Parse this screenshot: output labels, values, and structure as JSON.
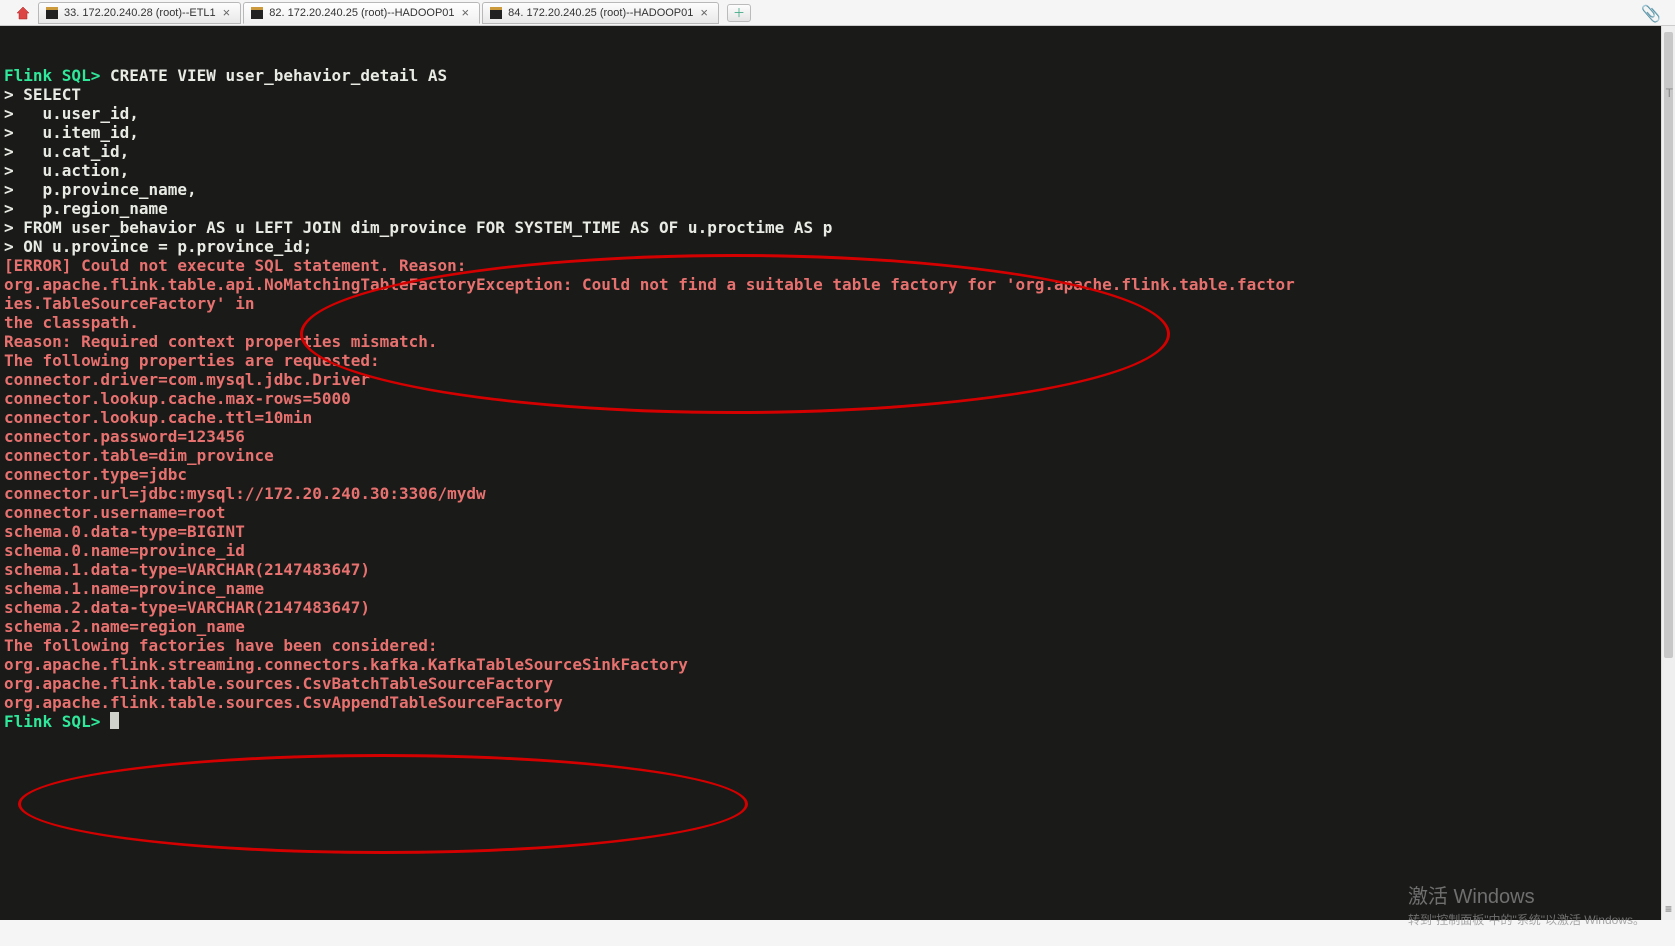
{
  "tabs": [
    {
      "label": "33. 172.20.240.28 (root)--ETL1",
      "active": false
    },
    {
      "label": "82. 172.20.240.25 (root)--HADOOP01",
      "active": true
    },
    {
      "label": "84. 172.20.240.25 (root)--HADOOP01",
      "active": false
    }
  ],
  "terminal": {
    "prompt": "Flink SQL>",
    "sql_first": " CREATE VIEW user_behavior_detail AS",
    "sql_cont": [
      "> SELECT ",
      ">   u.user_id,",
      ">   u.item_id,",
      ">   u.cat_id,",
      ">   u.action,",
      ">   p.province_name,",
      ">   p.region_name",
      "> FROM user_behavior AS u LEFT JOIN dim_province FOR SYSTEM_TIME AS OF u.proctime AS p",
      "> ON u.province = p.province_id;"
    ],
    "error": [
      "[ERROR] Could not execute SQL statement. Reason:",
      "org.apache.flink.table.api.NoMatchingTableFactoryException: Could not find a suitable table factory for 'org.apache.flink.table.factor",
      "ies.TableSourceFactory' in",
      "the classpath.",
      "",
      "Reason: Required context properties mismatch.",
      "",
      "The following properties are requested:",
      "connector.driver=com.mysql.jdbc.Driver",
      "connector.lookup.cache.max-rows=5000",
      "connector.lookup.cache.ttl=10min",
      "connector.password=123456",
      "connector.table=dim_province",
      "connector.type=jdbc",
      "connector.url=jdbc:mysql://172.20.240.30:3306/mydw",
      "connector.username=root",
      "schema.0.data-type=BIGINT",
      "schema.0.name=province_id",
      "schema.1.data-type=VARCHAR(2147483647)",
      "schema.1.name=province_name",
      "schema.2.data-type=VARCHAR(2147483647)",
      "schema.2.name=region_name",
      "",
      "The following factories have been considered:",
      "org.apache.flink.streaming.connectors.kafka.KafkaTableSourceSinkFactory",
      "org.apache.flink.table.sources.CsvBatchTableSourceFactory",
      "org.apache.flink.table.sources.CsvAppendTableSourceFactory"
    ],
    "prompt2": "Flink SQL>"
  },
  "watermark": {
    "line1": "激活 Windows",
    "line2": "转到\"控制面板\"中的\"系统\"以激活 Windows。"
  },
  "side_letter": "T"
}
